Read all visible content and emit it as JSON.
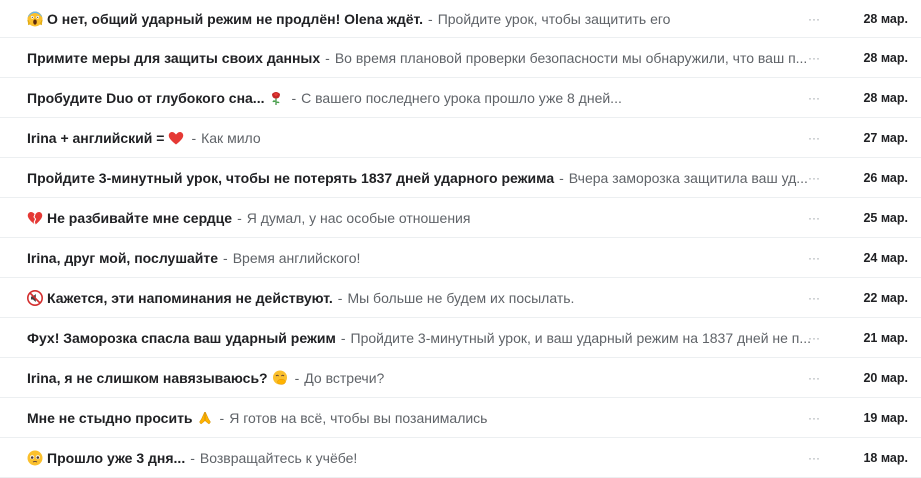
{
  "emails": [
    {
      "emoji": "scream-face-icon",
      "subject": "О нет, общий ударный режим не продлён! Olena ждёт.",
      "separator": "-",
      "snippet": "Пройдите урок, чтобы защитить его",
      "date": "28 мар.",
      "more": "···"
    },
    {
      "emoji": "",
      "subject": "Примите меры для защиты своих данных",
      "separator": "-",
      "snippet": "Во время плановой проверки безопасности мы обнаружили, что ваш п...",
      "date": "28 мар.",
      "more": "···"
    },
    {
      "emoji_after": "rose-icon",
      "subject": "Пробудите Duo от глубокого сна...",
      "separator": "-",
      "snippet": "С вашего последнего урока прошло уже 8 дней...",
      "date": "28 мар.",
      "more": "···"
    },
    {
      "emoji_after": "red-heart-icon",
      "subject": "Irina + английский =",
      "separator": "-",
      "snippet": "Как мило",
      "date": "27 мар.",
      "more": "···"
    },
    {
      "emoji": "",
      "subject": "Пройдите 3-минутный урок, чтобы не потерять 1837 дней ударного режима",
      "separator": "-",
      "snippet": "Вчера заморозка защитила ваш уд...",
      "date": "26 мар.",
      "more": "···"
    },
    {
      "emoji": "broken-heart-icon",
      "subject": "Не разбивайте мне сердце",
      "separator": "-",
      "snippet": "Я думал, у нас особые отношения",
      "date": "25 мар.",
      "more": "···"
    },
    {
      "emoji": "",
      "subject": "Irina, друг мой, послушайте",
      "separator": "-",
      "snippet": "Время английского!",
      "date": "24 мар.",
      "more": "···"
    },
    {
      "emoji": "muted-speaker-icon",
      "subject": "Кажется, эти напоминания не действуют.",
      "separator": "-",
      "snippet": "Мы больше не будем их посылать.",
      "date": "22 мар.",
      "more": "···"
    },
    {
      "emoji": "",
      "subject": "Фух! Заморозка спасла ваш ударный режим",
      "separator": "-",
      "snippet": "Пройдите 3-минутный урок, и ваш ударный режим на 1837 дней не п...",
      "date": "21 мар.",
      "more": "···"
    },
    {
      "emoji_after": "face-with-hand-over-mouth-icon",
      "subject": "Irina, я не слишком навязываюсь?",
      "separator": "-",
      "snippet": "До встречи?",
      "date": "20 мар.",
      "more": "···"
    },
    {
      "emoji_after": "folded-hands-icon",
      "subject": "Мне не стыдно просить",
      "separator": "-",
      "snippet": "Я готов на всё, чтобы вы позанимались",
      "date": "19 мар.",
      "more": "···"
    },
    {
      "emoji": "pleading-face-icon",
      "subject": "Прошло уже 3 дня...",
      "separator": "-",
      "snippet": "Возвращайтесь к учёбе!",
      "date": "18 мар.",
      "more": "···"
    }
  ]
}
